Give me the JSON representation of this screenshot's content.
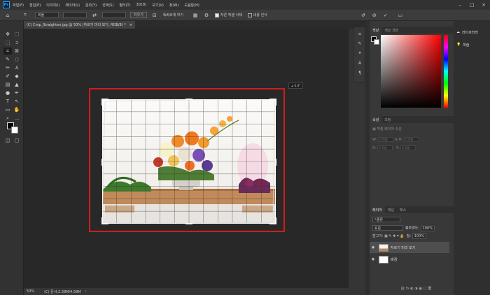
{
  "menu": [
    "파일(F)",
    "편집(E)",
    "이미지(I)",
    "레이어(L)",
    "문자(Y)",
    "선택(S)",
    "필터(T)",
    "3D(D)",
    "보기(V)",
    "창(W)",
    "도움말(H)"
  ],
  "options": {
    "ratio_label": "비율",
    "clear_label": "지우기",
    "straighten_label": "똑바르게 하기",
    "delete_pixels_label": "자른 픽셀 삭제",
    "content_aware_label": "내용 인식",
    "reset_icon": "undo-icon",
    "cancel_icon": "cancel-icon"
  },
  "document": {
    "tab_title": "(C) Crop_Straighten.jpg @ 50% (자르기 미리 보기, RGB/8) *",
    "rotation_readout": "∠-1.0°",
    "zoom": "50%",
    "doc_info": "(C) 문서:2.38M/4.58M"
  },
  "panels": {
    "color_tabs": [
      "색상",
      "색상 견본"
    ],
    "properties_tabs": [
      "속성",
      "조정"
    ],
    "properties_title": "픽셀 레이어 속성",
    "w_label": "W:",
    "h_label": "H:",
    "x_label": "X:",
    "y_label": "Y:",
    "w_placeholder": "0 픽셀",
    "h_placeholder": "0 픽셀",
    "x_placeholder": "0 픽셀",
    "y_placeholder": "0 픽셀",
    "layers_tabs": [
      "레이어",
      "채널",
      "패스"
    ],
    "search_label": "종류",
    "blend_mode": "표준",
    "opacity_label": "불투명도:",
    "opacity_value": "100%",
    "lock_label": "잠그기:",
    "fill_label": "칠:",
    "fill_value": "100%",
    "layers": [
      {
        "name": "자르기 미리 보기",
        "selected": true
      },
      {
        "name": "배경",
        "selected": false
      }
    ]
  },
  "side_panel": {
    "libraries_label": "라이브러리",
    "learn_label": "학습"
  },
  "colors": {
    "crop_highlight": "#d01c1c",
    "accent": "#31a8ff"
  }
}
